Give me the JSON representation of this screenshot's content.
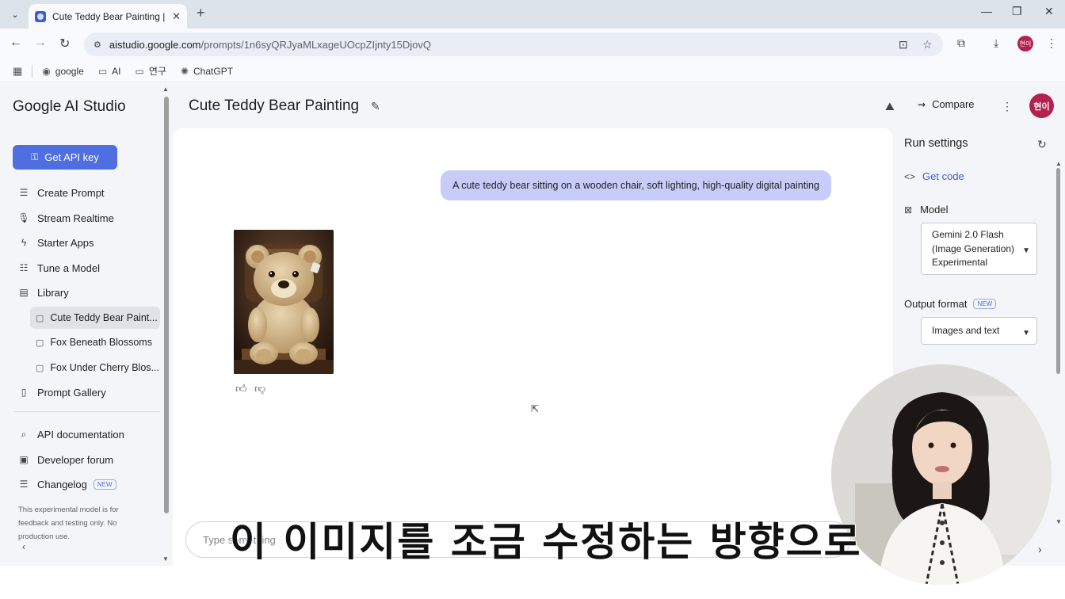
{
  "browser": {
    "tab_title": "Cute Teddy Bear Painting | Go",
    "url_host": "aistudio.google.com",
    "url_path": "/prompts/1n6syQRJyaMLxageUOcpZIjnty15DjovQ",
    "profile_initials": "현이",
    "bookmarks": [
      {
        "label": "google",
        "icon": "globe-icon"
      },
      {
        "label": "AI",
        "icon": "folder-icon"
      },
      {
        "label": "연구",
        "icon": "folder-icon"
      },
      {
        "label": "ChatGPT",
        "icon": "chatgpt-icon"
      }
    ]
  },
  "sidebar": {
    "brand": "Google AI Studio",
    "api_key_label": "Get API key",
    "nav": [
      {
        "label": "Create Prompt",
        "icon": "create-prompt-icon"
      },
      {
        "label": "Stream Realtime",
        "icon": "mic-icon"
      },
      {
        "label": "Starter Apps",
        "icon": "bolt-icon"
      },
      {
        "label": "Tune a Model",
        "icon": "tune-icon"
      },
      {
        "label": "Library",
        "icon": "library-icon"
      }
    ],
    "library": [
      {
        "label": "Cute Teddy Bear Paint...",
        "active": true
      },
      {
        "label": "Fox Beneath Blossoms",
        "active": false
      },
      {
        "label": "Fox Under Cherry Blos...",
        "active": false
      }
    ],
    "prompt_gallery": "Prompt Gallery",
    "bottom": [
      {
        "label": "API documentation",
        "icon": "docs-icon"
      },
      {
        "label": "Developer forum",
        "icon": "forum-icon"
      },
      {
        "label": "Changelog",
        "icon": "changelog-icon",
        "badge": "NEW"
      }
    ],
    "note": "This experimental model is for feedback and testing only. No production use."
  },
  "header": {
    "title": "Cute Teddy Bear Painting",
    "compare_label": "Compare"
  },
  "chat": {
    "user_message": "A cute teddy bear sitting on a wooden chair, soft lighting, high-quality digital painting",
    "input_placeholder": "Type something"
  },
  "run_settings": {
    "title": "Run settings",
    "get_code": "Get code",
    "model_label": "Model",
    "model_value": [
      "Gemini 2.0 Flash",
      "(Image Generation)",
      "Experimental"
    ],
    "output_format_label": "Output format",
    "output_format_badge": "NEW",
    "output_format_value": "Images and text"
  },
  "video": {
    "subtitle": "이 이미지를 조금 수정하는 방향으로"
  },
  "colors": {
    "accent": "#4f6fe0",
    "user_bubble": "#c7cdf8",
    "avatar": "#b3214f"
  }
}
